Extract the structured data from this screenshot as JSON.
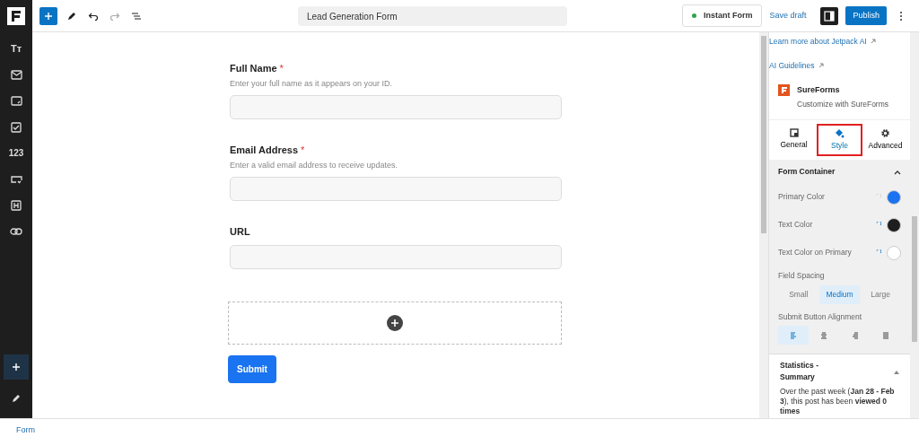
{
  "toolbar": {
    "document_title": "Lead Generation Form",
    "instant_form": "Instant Form",
    "save_draft": "Save draft",
    "publish": "Publish"
  },
  "block_sidebar": {
    "text_label": "Tт",
    "number_label": "123"
  },
  "fields": [
    {
      "label": "Full Name",
      "required_mark": "*",
      "help": "Enter your full name as it appears on your ID."
    },
    {
      "label": "Email Address",
      "required_mark": "*",
      "help": "Enter a valid email address to receive updates."
    },
    {
      "label": "URL"
    }
  ],
  "submit": "Submit",
  "breadcrumb": "Form",
  "panel": {
    "links": [
      "Learn more about Jetpack AI",
      "AI Guidelines"
    ],
    "plugin": {
      "name": "SureForms",
      "description": "Customize with SureForms"
    },
    "tabs": [
      {
        "label": "General",
        "selected": false,
        "highlighted": false
      },
      {
        "label": "Style",
        "selected": true,
        "highlighted": true
      },
      {
        "label": "Advanced",
        "selected": false,
        "highlighted": false
      }
    ],
    "section": {
      "title": "Form Container",
      "expanded": true
    },
    "colors": [
      {
        "label": "Primary Color",
        "color": "#1a73f0"
      },
      {
        "label": "Text Color",
        "color": "#1e1e1e"
      },
      {
        "label": "Text Color on Primary",
        "color": "#ffffff"
      }
    ],
    "spacing": {
      "label": "Field Spacing",
      "options": [
        {
          "label": "Small",
          "selected": false
        },
        {
          "label": "Medium",
          "selected": true
        },
        {
          "label": "Large",
          "selected": false
        }
      ]
    },
    "alignment": {
      "label": "Submit Button Alignment",
      "options": [
        {
          "selected": true
        },
        {
          "selected": false
        },
        {
          "selected": false
        },
        {
          "selected": false
        }
      ]
    },
    "statistics": {
      "title": "Statistics - Summary",
      "expanded": true,
      "text": "Over the past week (**Jan 28 - Feb 3**), this post has been **viewed 0 times**"
    }
  }
}
